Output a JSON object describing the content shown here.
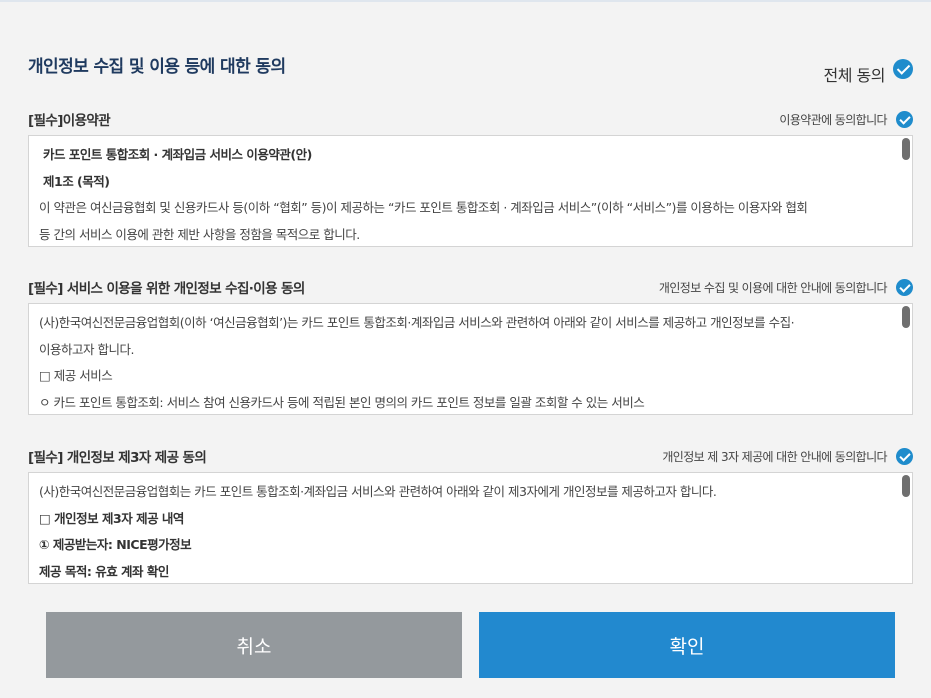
{
  "header": {
    "title": "개인정보 수집 및 이용 등에 대한 동의",
    "all_agree_label": "전체 동의"
  },
  "sections": [
    {
      "title": "[필수]이용약관",
      "agree_label": "이용약관에 동의합니다",
      "lines": [
        "카드 포인트 통합조회 · 계좌입금 서비스 이용약관(안)",
        "제1조 (목적)",
        "이 약관은 여신금융협회 및 신용카드사 등(이하 “협회” 등)이 제공하는 “카드 포인트 통합조회 · 계좌입금 서비스”(이하 “서비스”)를 이용하는 이용자와 협회",
        "등 간의 서비스 이용에 관한 제반 사항을 정함을 목적으로 합니다."
      ]
    },
    {
      "title": "[필수] 서비스 이용을 위한 개인정보 수집·이용 동의",
      "agree_label": "개인정보 수집 및 이용에 대한 안내에 동의합니다",
      "lines": [
        "(사)한국여신전문금융업협회(이하 ‘여신금융협회’)는 카드 포인트 통합조회·계좌입금 서비스와 관련하여 아래와 같이 서비스를 제공하고 개인정보를 수집·",
        "이용하고자 합니다.",
        "□ 제공 서비스",
        "ㅇ 카드 포인트 통합조회: 서비스 참여 신용카드사 등에 적립된 본인 명의의 카드 포인트 정보를 일괄 조회할 수 있는 서비스"
      ]
    },
    {
      "title": "[필수] 개인정보 제3자 제공 동의",
      "agree_label": "개인정보 제 3자 제공에 대한 안내에 동의합니다",
      "lines": [
        "(사)한국여신전문금융업협회는 카드 포인트 통합조회·계좌입금 서비스와 관련하여 아래와 같이 제3자에게 개인정보를 제공하고자 합니다.",
        "□ 개인정보 제3자 제공 내역",
        "① 제공받는자: NICE평가정보",
        "제공 목적: 유효 계좌 확인"
      ]
    }
  ],
  "buttons": {
    "cancel": "취소",
    "confirm": "확인"
  },
  "colors": {
    "accent": "#2289cf",
    "check": "#1f8ccc",
    "cancel": "#94999d",
    "title": "#1f3a5f"
  }
}
